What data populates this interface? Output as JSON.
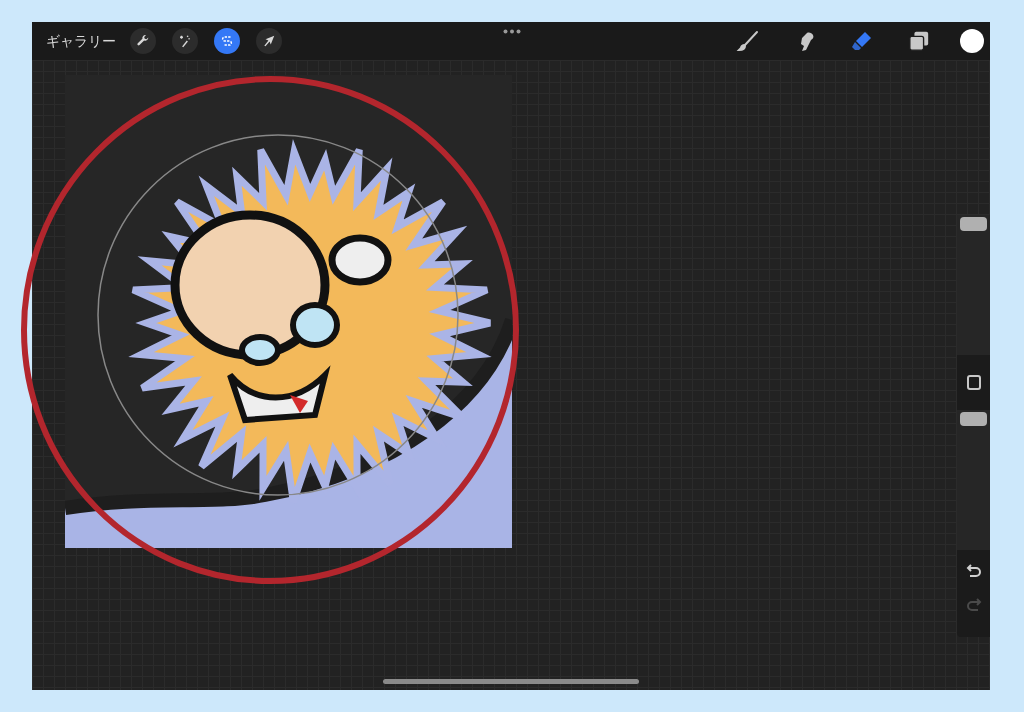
{
  "toolbar": {
    "gallery_label": "ギャラリー",
    "left_tools": [
      {
        "kind": "wrench",
        "selected": false
      },
      {
        "kind": "wand",
        "selected": false
      },
      {
        "kind": "selection",
        "selected": true
      },
      {
        "kind": "transform",
        "selected": false
      }
    ],
    "right_tools": [
      {
        "kind": "brush",
        "selected": false
      },
      {
        "kind": "smudge",
        "selected": false
      },
      {
        "kind": "eraser",
        "selected": true
      },
      {
        "kind": "layers",
        "selected": false
      }
    ]
  },
  "sidebar": {
    "size_slider": {
      "level": 1
    },
    "opacity_slider": {
      "level": 1
    },
    "undo_disabled": false,
    "redo_disabled": true
  }
}
